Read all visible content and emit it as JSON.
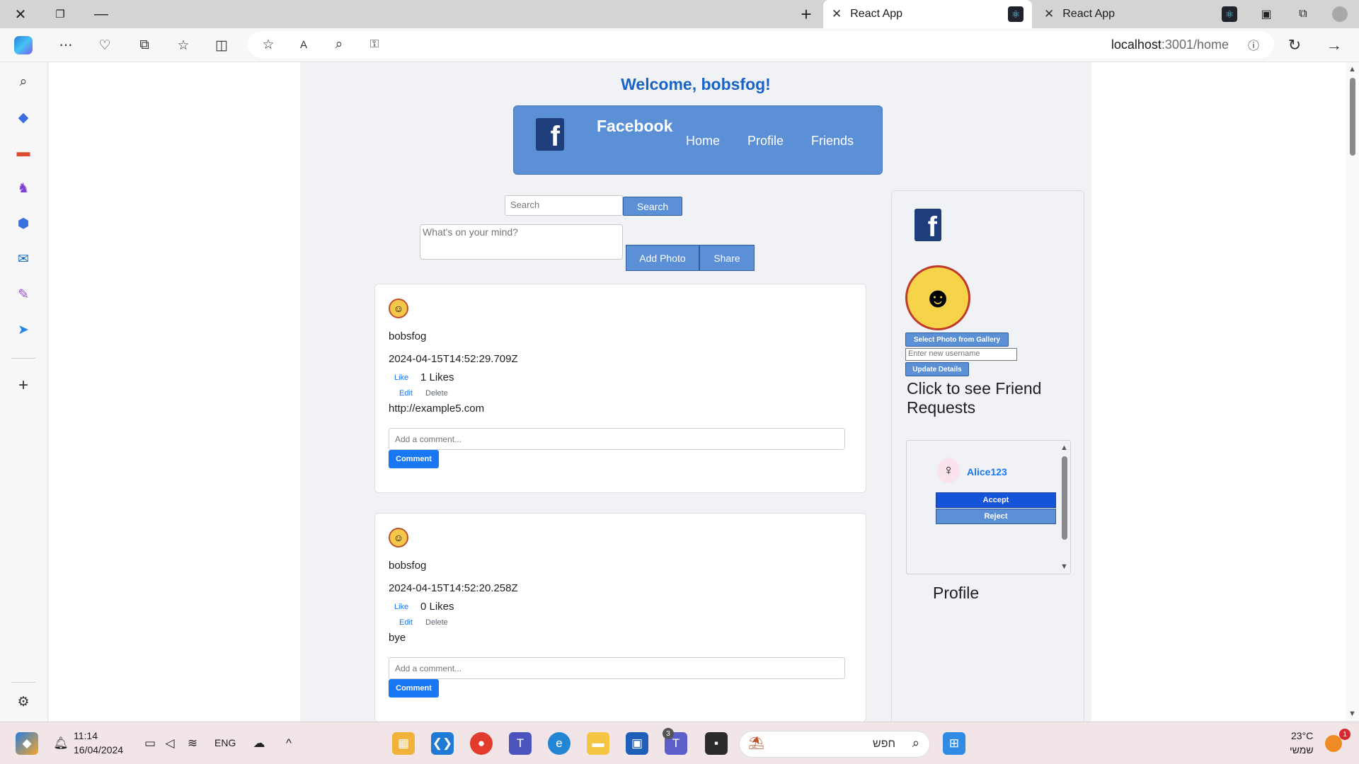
{
  "browser": {
    "tabs": [
      {
        "title": "React App",
        "active": true
      },
      {
        "title": "React App",
        "active": false
      }
    ],
    "url_host": "localhost",
    "url_rest": ":3001/home"
  },
  "page": {
    "welcome": "Welcome, bobsfog!",
    "brand": "Facebook",
    "nav": [
      "Home",
      "Profile",
      "Friends"
    ],
    "search_placeholder": "Search",
    "search_button": "Search",
    "post_placeholder": "What's on your mind?",
    "add_photo_button": "Add Photo",
    "share_button": "Share",
    "posts": [
      {
        "username": "bobsfog",
        "date": "2024-04-15T14:52:29.709Z",
        "like_label": "Like",
        "likes": "1 Likes",
        "edit_label": "Edit",
        "delete_label": "Delete",
        "content": "http://example5.com",
        "comment_placeholder": "Add a comment...",
        "comment_button": "Comment"
      },
      {
        "username": "bobsfog",
        "date": "2024-04-15T14:52:20.258Z",
        "like_label": "Like",
        "likes": "0 Likes",
        "edit_label": "Edit",
        "delete_label": "Delete",
        "content": "bye",
        "comment_placeholder": "Add a comment...",
        "comment_button": "Comment"
      }
    ],
    "sidebar": {
      "select_photo_button": "Select Photo from Gallery",
      "username_placeholder": "Enter new username",
      "update_button": "Update Details",
      "friend_requests_title": "Click to see Friend Requests",
      "request": {
        "name": "Alice123",
        "accept": "Accept",
        "reject": "Reject"
      },
      "profile_label": "Profile"
    }
  },
  "taskbar": {
    "time": "11:14",
    "date": "16/04/2024",
    "language": "ENG",
    "search_text": "חפש",
    "weather_temp": "23°C",
    "weather_desc": "שמשי",
    "teams_badge": "3",
    "notification_badge": "1"
  },
  "colors": {
    "accent_blue": "#5b8fd6",
    "link_blue": "#1877f2",
    "welcome_blue": "#1a63c6",
    "fb_dark": "#1e3d7b"
  }
}
